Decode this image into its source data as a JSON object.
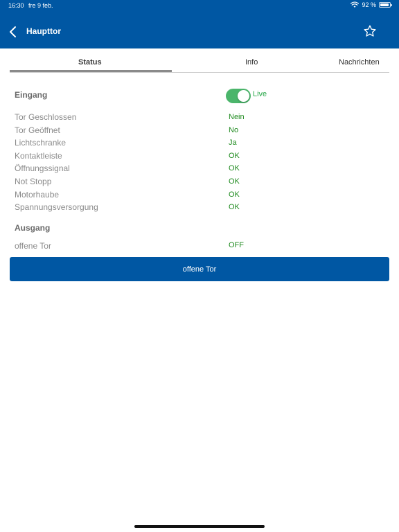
{
  "status_bar": {
    "time": "16:30",
    "date": "fre 9 feb.",
    "battery_text": "92 %",
    "battery_level": 0.92,
    "wifi_icon": "wifi-icon",
    "battery_icon": "battery-icon"
  },
  "nav": {
    "title": "Haupttor",
    "back_icon": "chevron-left-icon",
    "favorite_icon": "star-outline-icon"
  },
  "tabs": [
    {
      "label": "Status",
      "active": true
    },
    {
      "label": "Info",
      "active": false
    },
    {
      "label": "Nachrichten",
      "active": false
    }
  ],
  "inputs_section": {
    "title": "Eingang",
    "live_toggle": {
      "on": true,
      "label": "Live"
    },
    "rows": [
      {
        "label": "Tor Geschlossen",
        "value": "Nein"
      },
      {
        "label": "Tor Geöffnet",
        "value": "No"
      },
      {
        "label": "Lichtschranke",
        "value": "Ja"
      },
      {
        "label": "Kontaktleiste",
        "value": "OK"
      },
      {
        "label": "Öffnungssignal",
        "value": "OK"
      },
      {
        "label": "Not Stopp",
        "value": "OK"
      },
      {
        "label": "Motorhaube",
        "value": "OK"
      },
      {
        "label": "Spannungsversorgung",
        "value": "OK"
      }
    ]
  },
  "outputs_section": {
    "title": "Ausgang",
    "rows": [
      {
        "label": "offene Tor",
        "value": "OFF"
      }
    ]
  },
  "action_button": {
    "label": "offene Tor"
  },
  "colors": {
    "brand_blue": "#0057a3",
    "status_green": "#1e8a1e",
    "toggle_green": "#4bb56b"
  }
}
